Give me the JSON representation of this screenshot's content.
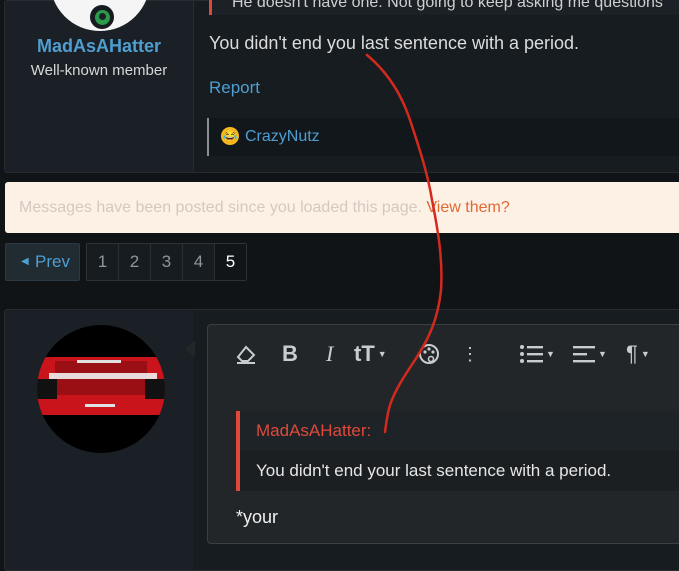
{
  "post": {
    "username": "MadAsAHatter",
    "user_title": "Well-known member",
    "quote_stub": "He doesn't have one. Not going to keep asking me questions",
    "message": "You didn't end you last sentence with a period.",
    "report": "Report",
    "reaction_user": "CrazyNutz",
    "reaction_icon": "laughing-emoji-icon"
  },
  "notice": {
    "text": "Messages have been posted since you loaded this page.",
    "link": "View them?"
  },
  "pagination": {
    "prev": "Prev",
    "pages": [
      "1",
      "2",
      "3",
      "4",
      "5"
    ],
    "current": "5"
  },
  "editor": {
    "toolbar_icons": [
      "eraser-icon",
      "bold-icon",
      "italic-icon",
      "text-size-icon",
      "palette-icon",
      "more-vertical-icon",
      "list-icon",
      "align-icon",
      "paragraph-icon"
    ],
    "quote_author": "MadAsAHatter:",
    "quote_body": "You didn't end your last sentence with a period.",
    "reply_text": "*your"
  },
  "colors": {
    "accent_blue": "#4f9ed1",
    "quote_red": "#e0493a",
    "annotation_red": "#d42a1e",
    "notice_bg": "#fdf1e6"
  }
}
